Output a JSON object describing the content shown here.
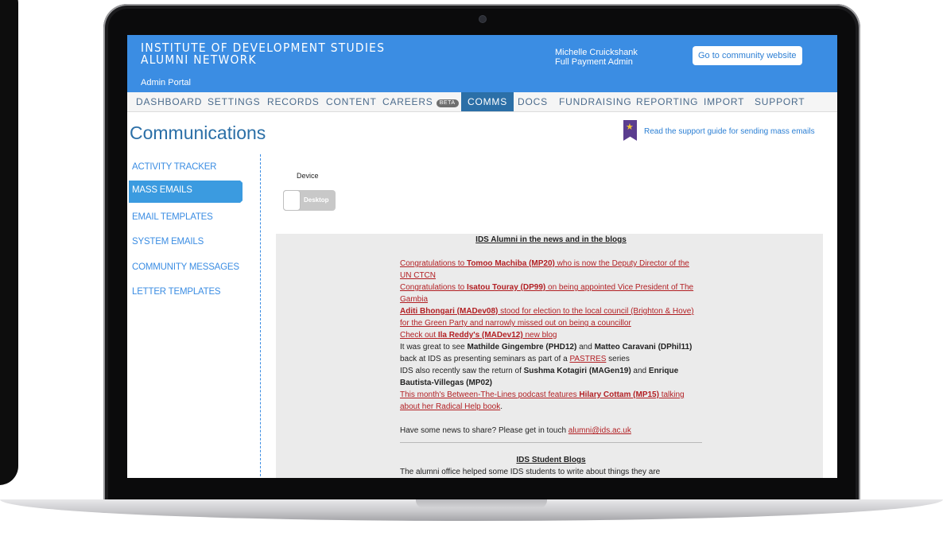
{
  "header": {
    "title": "INSTITUTE OF DEVELOPMENT STUDIES ALUMNI NETWORK",
    "subtitle": "Admin Portal",
    "user_name": "Michelle Cruickshank",
    "user_role": "Full Payment Admin",
    "community_button": "Go to community website"
  },
  "nav": {
    "items": [
      "DASHBOARD",
      "SETTINGS",
      "RECORDS",
      "CONTENT",
      "CAREERS",
      "COMMS",
      "DOCS",
      "FUNDRAISING",
      "REPORTING",
      "IMPORT",
      "SUPPORT"
    ],
    "beta_badge": "BETA",
    "active": "COMMS"
  },
  "page": {
    "title": "Communications",
    "help_link": "Read the support guide for sending mass emails"
  },
  "sidebar": {
    "items": [
      "ACTIVITY TRACKER",
      "MASS EMAILS",
      "EMAIL TEMPLATES",
      "SYSTEM EMAILS",
      "COMMUNITY MESSAGES",
      "LETTER TEMPLATES"
    ],
    "active": "MASS EMAILS"
  },
  "device": {
    "label": "Device",
    "value": "Desktop"
  },
  "email": {
    "heading": "IDS Alumni in the news and in the blogs",
    "p1_a": "Congratulations to ",
    "p1_b": "Tomoo Machiba (MP20)",
    "p1_c": " who is now the Deputy Director of the UN CTCN",
    "p2_a": "Congratulations to ",
    "p2_b": "Isatou Touray (DP99)",
    "p2_c": " on being appointed Vice President of The Gambia",
    "p3_a": "Aditi Bhongari (MADev08)",
    "p3_b": " stood for election to the local council (Brighton & Hove) for the Green Party and narrowly missed out on being a councillor",
    "p4_a": "Check out ",
    "p4_b": "Ila Reddy's (MADev12)",
    "p4_c": " new blog",
    "p5_a": "It was great to see ",
    "p5_b": "Mathilde Gingembre (PHD12)",
    "p5_c": " and ",
    "p5_d": "Matteo Caravani (DPhil11)",
    "p5_e": " back at IDS as presenting seminars as part of a ",
    "p5_f": "PASTRES",
    "p5_g": " series",
    "p6_a": "IDS also recently saw the return of ",
    "p6_b": "Sushma Kotagiri (MAGen19)",
    "p6_c": " and ",
    "p6_d": "Enrique Bautista-Villegas (MP02)",
    "p7_a": "This month's Between-The-Lines podcast features ",
    "p7_b": "Hilary Cottam (MP15)",
    "p7_c": " talking about her Radical Help book",
    "p7_d": ".",
    "p8_a": "Have some news to share? Please get in touch ",
    "p8_b": "alumni@ids.ac.uk",
    "heading2": "IDS Student Blogs",
    "p9": "The alumni office helped some IDS students to write about things they are"
  }
}
